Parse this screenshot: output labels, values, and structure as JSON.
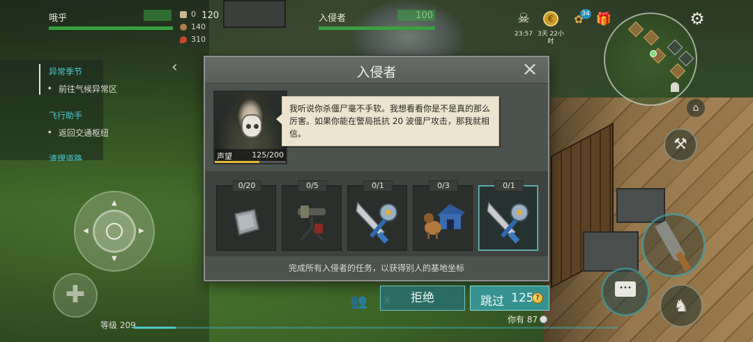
{
  "player": {
    "name": "哦乎",
    "hp": 120
  },
  "resources": [
    {
      "name": "bullet-icon",
      "value": "0"
    },
    {
      "name": "food-icon",
      "value": "140"
    },
    {
      "name": "fuel-icon",
      "value": "310"
    }
  ],
  "enemy": {
    "name": "入侵者",
    "hp": 100
  },
  "hud": {
    "skull_timer": "23:57",
    "event_timer": "3天 22小时",
    "badge_count": "34"
  },
  "quests": [
    {
      "title": "异常季节",
      "subtitle": "前往气候异常区"
    },
    {
      "title": "飞行助手",
      "subtitle": "返回交通枢纽"
    },
    {
      "title": "清理道路"
    }
  ],
  "dialog": {
    "title": "入侵者",
    "close_icon": "×",
    "reputation_label": "声望",
    "reputation_value": "125/200",
    "reputation_fraction": 0.625,
    "speech": "我听说你杀僵尸毫不手软。我想看看你是不是真的那么厉害。如果你能在警局抵抗 20 波僵尸攻击，那我就相信。",
    "tasks": [
      {
        "count": "0/20",
        "icon": "metal-plate-icon",
        "selected": false
      },
      {
        "count": "0/5",
        "icon": "turret-icon",
        "selected": false
      },
      {
        "count": "0/1",
        "icon": "machete-saw-icon",
        "selected": false
      },
      {
        "count": "0/3",
        "icon": "dog-kennel-icon",
        "selected": false
      },
      {
        "count": "0/1",
        "icon": "machete-saw-icon",
        "selected": true
      }
    ],
    "hint": "完成所有入侵者的任务，以获得别人的基地坐标"
  },
  "buttons": {
    "refuse": "拒绝",
    "skip": "跳过",
    "skip_cost": "125",
    "coin_symbol": "?"
  },
  "footer": {
    "level_label": "等级 209",
    "you_have": "你有 87"
  },
  "colors": {
    "accent": "#4ec8d0",
    "hp_bar": "#3aa043",
    "reputation": "#e7b83c",
    "dialog_bg": "#4c524e"
  }
}
